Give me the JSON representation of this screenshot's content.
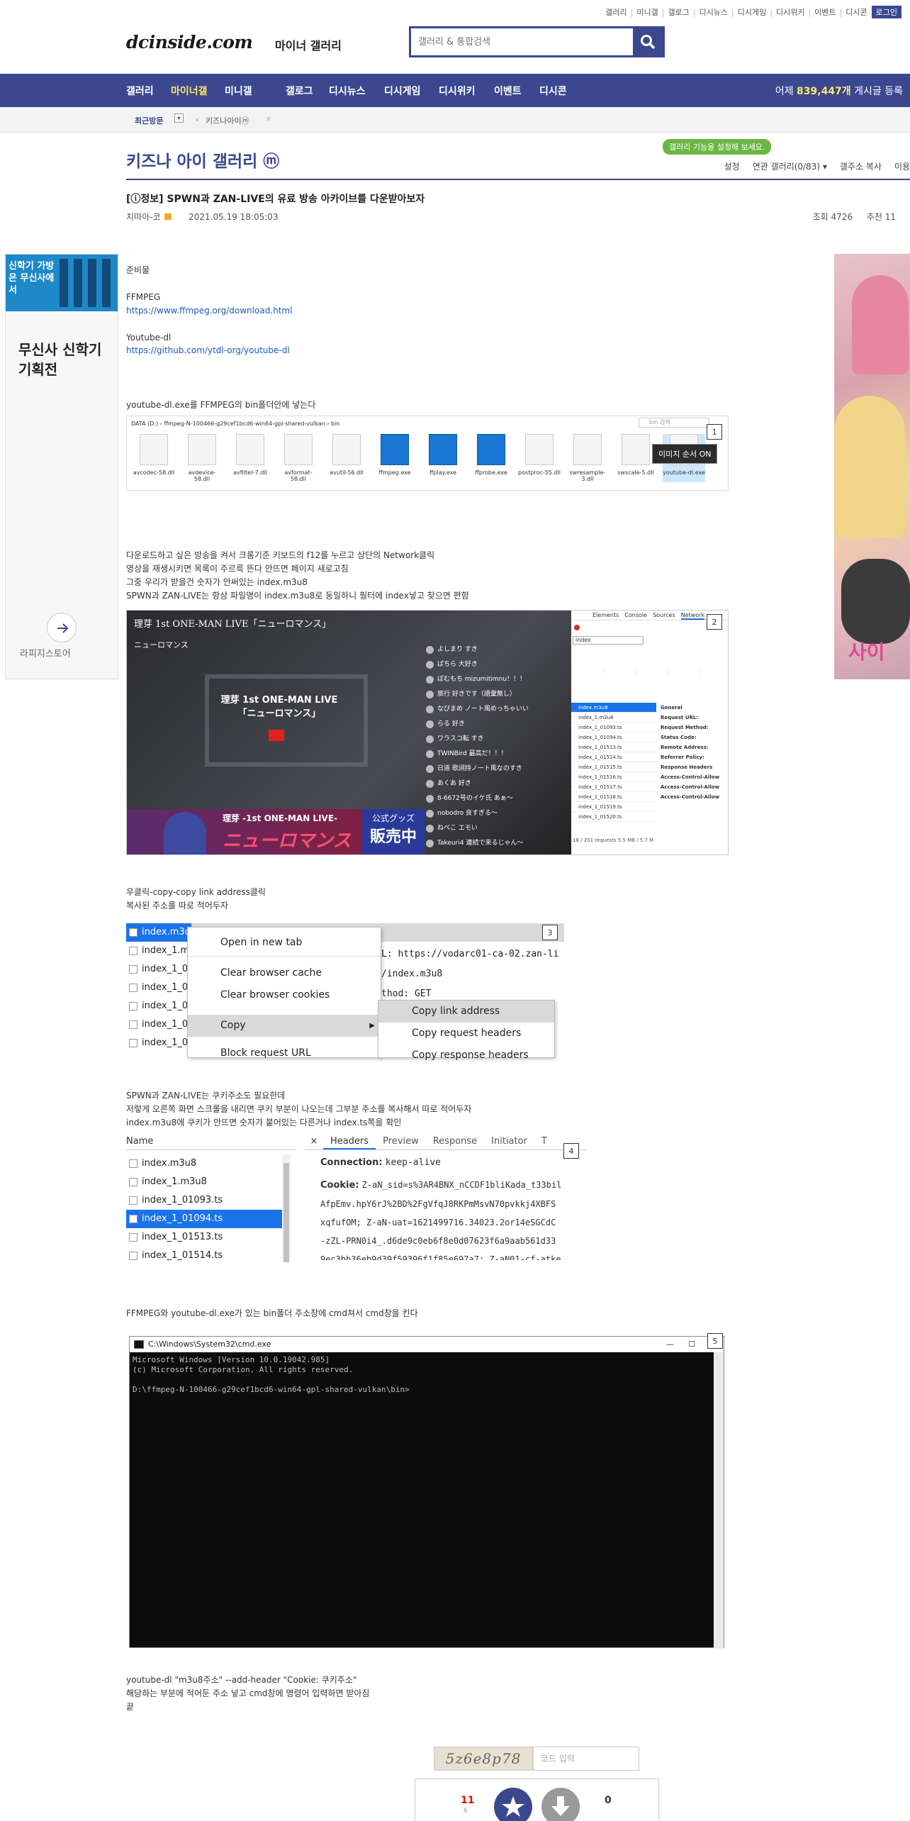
{
  "header": {
    "top_links": [
      "갤러리",
      "미니갤",
      "갤로그",
      "디시뉴스",
      "디시게임",
      "디시위키",
      "이벤트",
      "디시콘"
    ],
    "login_label": "로그인",
    "logo": "dcinside.com",
    "logo_sub": "마이너 갤러리",
    "search_placeholder": "갤러리 & 통합검색"
  },
  "gnb": {
    "items": [
      "갤러리",
      "마이너갤",
      "미니갤",
      "갤로그",
      "디시뉴스",
      "디시게임",
      "디시위키",
      "이벤트",
      "디시콘"
    ],
    "visitors_prefix": "어제",
    "visitors_count": "839,447개",
    "visitors_suffix": "게시글 등록"
  },
  "recent": {
    "label": "최근방문",
    "item": "키즈나아이ⓜ",
    "close": "×"
  },
  "gallery": {
    "title": "키즈나 아이 갤러리 ⓜ",
    "tip": "갤러리 기능을 설정해 보세요.",
    "menu": [
      "설정",
      "연관 갤러리(0/83) ▾",
      "갤주소 복사",
      "이용"
    ]
  },
  "post": {
    "title": "[ⓘ정보] SPWN과 ZAN-LIVE의 유료 방송 아카이브를 다운받아보자",
    "author": "치마아-코",
    "date": "2021.05.19 18:05:03",
    "views_label": "조회 4726",
    "recommend_label": "추천 11"
  },
  "body": {
    "prep": "준비물",
    "ffmpeg": "FFMPEG",
    "ffmpeg_url": "https://www.ffmpeg.org/download.html",
    "ytdl": "Youtube-dl",
    "ytdl_url": "https://github.com/ytdl-org/youtube-dl",
    "step1": "youtube-dl.exe를 FFMPEG의 bin폴더안에 넣는다",
    "step2_lines": [
      "다운로드하고 싶은 방송을 켜서 크롬기준 키보드의 f12를 누르고 상단의 Network클릭",
      "영상을 재생시키면 목록이 주르륵 뜬다 안뜨면 페이지 새로고침",
      "그중 우리가 받을건 숫자가 안써있는 index.m3u8",
      "SPWN과 ZAN-LIVE는 항상 파일명이 index.m3u8로 동일하니 필터에 index넣고 찾으면 편함"
    ],
    "step3_lines": [
      "우클릭-copy-copy link address클릭",
      "복사된 주소를 따로 적어두자"
    ],
    "step4_lines": [
      "SPWN과 ZAN-LIVE는 쿠키주소도 필요한데",
      "저렇게 오른쪽 화면 스크롤을 내리면 쿠키 부분이 나오는데 그부분 주소를 복사해서 따로 적어두자",
      "index.m3u8에 쿠키가 안뜨면 숫자가 붙어있는 다른거나 index.ts쪽을 확인"
    ],
    "step5": "FFMPEG와 youtube-dl.exe가 있는 bin폴더 주소창에 cmd쳐서 cmd창을 킨다",
    "final_lines": [
      "youtube-dl \"m3u8주소\" --add-header \"Cookie: 쿠키주소\"",
      "해당하는 부분에 적어둔 주소 넣고 cmd창에 명령어 입력하면 받아짐",
      "끝"
    ]
  },
  "shot1": {
    "tag": "1",
    "path": "DATA (D:)  ›  ffmpeg-N-100466-g29cef1bcd6-win64-gpl-shared-vulkan  ›  bin",
    "search": "bin 검색",
    "files": [
      "avcodec-58.dll",
      "avdevice-58.dll",
      "avfilter-7.dll",
      "avformat-58.dll",
      "avutil-56.dll",
      "ffmpeg.exe",
      "ffplay.exe",
      "ffprobe.exe",
      "postproc-55.dll",
      "swresample-3.dll",
      "swscale-5.dll",
      "youtube-dl.exe"
    ],
    "tooltip": "이미지 순서 ON"
  },
  "shot2": {
    "tag": "2",
    "video_title": "理芽 1st ONE-MAN LIVE「ニューロマンス」",
    "logo": "ニューロマンス",
    "center_line1": "理芽 1st ONE-MAN LIVE",
    "center_line2": "「ニューロマンス」",
    "banner": "理芽 -1st ONE-MAN LIVE-",
    "banner_big": "ニューロマンス",
    "merch_line1": "公式グッズ",
    "merch_line2": "販売中",
    "chat": [
      "よしまり  すき",
      "ぱちら  大好き",
      "ぽむもち  mizumitimnu！！！",
      "旅行  好きです（語彙無し）",
      "なびまめ  ノート風めっちゃいい",
      "らる  好き",
      "ワラスコ転  すき",
      "TWINBird  最高だ！！！",
      "日道  歌詞持ノート風なのすき",
      "あくあ  好き",
      "8-6672号のイケ氏  あぁ～",
      "nobodro  良すぎる～",
      "ねべこ  エモい",
      "Takeuri4  連続で来るじゃん～"
    ],
    "devtools_tabs": [
      "Elements",
      "Console",
      "Sources",
      "Network"
    ],
    "filter": "index",
    "list": [
      "index.m3u8",
      "index_1.m3u8",
      "index_1_01093.ts",
      "index_1_01094.ts",
      "index_1_01513.ts",
      "index_1_01514.ts",
      "index_1_01515.ts",
      "index_1_01516.ts",
      "index_1_01517.ts",
      "index_1_01518.ts",
      "index_1_01519.ts",
      "index_1_01520.ts"
    ],
    "general": [
      "General",
      "Request URL:",
      "Request Method:",
      "Status Code:",
      "Remote Address:",
      "Referrer Policy:",
      "Response Headers",
      "Access-Control-Allow",
      "Access-Control-Allow",
      "Access-Control-Allow"
    ],
    "status": "18 / 201 requests  5.5 MB / 5.7 M"
  },
  "shot3": {
    "tag": "3",
    "rows": [
      "index.m3u8",
      "index_1.m",
      "index_1_0",
      "index_1_0",
      "index_1_0",
      "index_1_0",
      "index_1_0"
    ],
    "menu": [
      "Open in new tab",
      "Clear browser cache",
      "Clear browser cookies",
      "Copy",
      "Block request URL"
    ],
    "submenu": [
      "Copy link address",
      "Copy request headers",
      "Copy response headers"
    ],
    "url_text": "L: https://vodarc01-ca-02.zan-li",
    "path_text": "/index.m3u8",
    "method_text": "thod: GET"
  },
  "shot4": {
    "tag": "4",
    "name_header": "Name",
    "rows": [
      "index.m3u8",
      "index_1.m3u8",
      "index_1_01093.ts",
      "index_1_01094.ts",
      "index_1_01513.ts",
      "index_1_01514.ts"
    ],
    "tabs": [
      "Headers",
      "Preview",
      "Response",
      "Initiator",
      "T"
    ],
    "close": "×",
    "connection_label": "Connection:",
    "connection_value": "keep-alive",
    "cookie_label": "Cookie:",
    "cookie_lines": [
      "Z-aN_sid=s%3AR4BNX_nCCDF1bliKada_t33bil",
      "AfpEmv.hpY6rJ%2BD%2FgVfqJ8RKPmMsvN70pvkkj4XBFS",
      "xqfufOM; Z-aN-uat=1621499716.34023.2or14eSGCdC",
      "-zZL-PRN0i4_.d6de9c0eb6f8e0d07623f6a9aab561d33",
      "9ec3bb36eb9d39f59396f1f85e697a7; Z-aN01-cf-atke"
    ]
  },
  "shot5": {
    "tag": "5",
    "title": "C:\\Windows\\System32\\cmd.exe",
    "console": "Microsoft Windows [Version 10.0.19042.985]\n(c) Microsoft Corporation. All rights reserved.\n\nD:\\ffmpeg-N-100466-g29cef1bcd6-win64-gpl-shared-vulkan\\bin>"
  },
  "side": {
    "left_title": "무신사 신학기 기획전",
    "left_brand": "라피지스토어",
    "left_banner_text": "신학기 가방은 무신사에서",
    "right_text": "사이"
  },
  "captcha": {
    "code": "5z6e8p78",
    "placeholder": "코드 입력"
  },
  "vote": {
    "up_count": "11",
    "fix_count": "6",
    "down_count": "0"
  },
  "colors": {
    "brand": "#3b4890",
    "highlight": "#ffe76a",
    "link": "#1a5bbd",
    "tip_green": "#6bb644",
    "vote_red": "#d31900"
  }
}
